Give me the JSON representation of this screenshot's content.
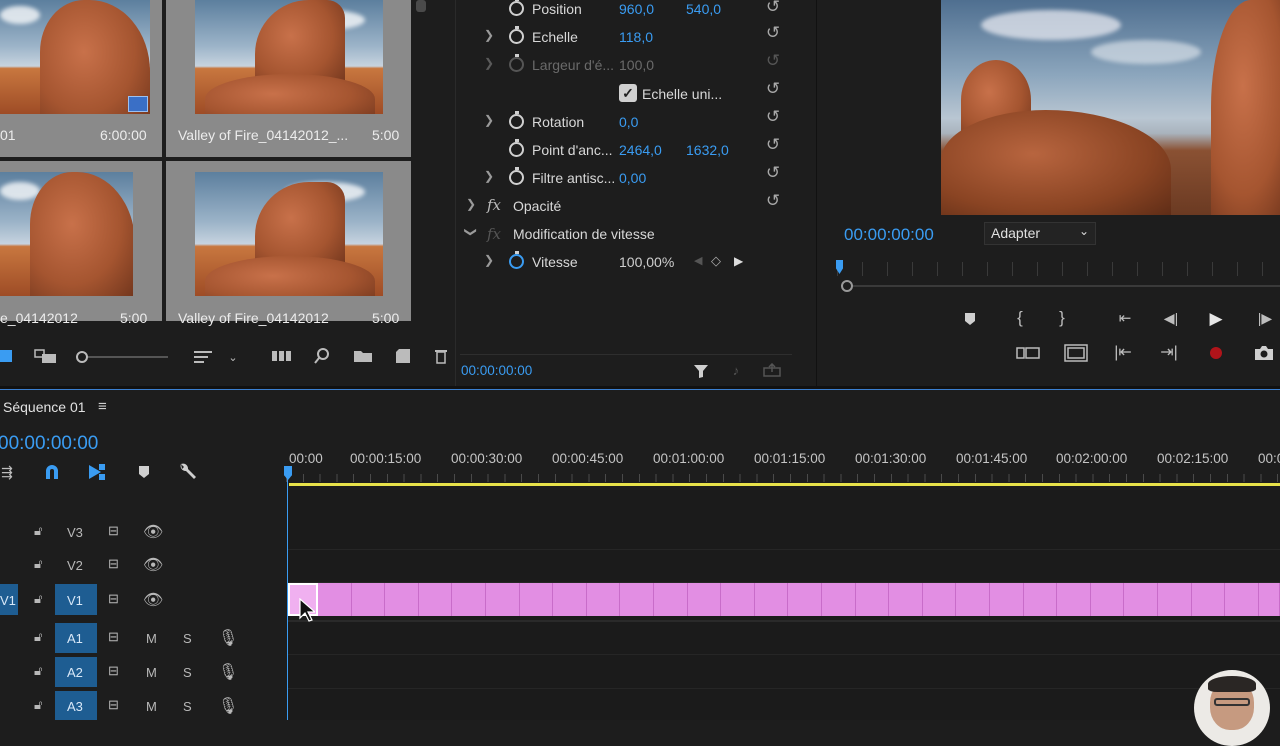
{
  "project": {
    "items": [
      {
        "name": "01",
        "duration": "6:00:00"
      },
      {
        "name": "Valley of Fire_04142012_...",
        "duration": "5:00"
      },
      {
        "name": "e_04142012",
        "duration": "5:00"
      },
      {
        "name": "Valley of Fire_04142012",
        "duration": "5:00"
      }
    ]
  },
  "effects": {
    "rows": [
      {
        "label": "Position",
        "v1": "960,0",
        "v2": "540,0"
      },
      {
        "label": "Echelle",
        "v1": "118,0",
        "v2": ""
      },
      {
        "label": "Largeur d'é...",
        "v1": "100,0",
        "v2": ""
      },
      {
        "label": "Echelle uni...",
        "v1": "",
        "v2": ""
      },
      {
        "label": "Rotation",
        "v1": "0,0",
        "v2": ""
      },
      {
        "label": "Point d'anc...",
        "v1": "2464,0",
        "v2": "1632,0"
      },
      {
        "label": "Filtre antisc...",
        "v1": "0,00",
        "v2": ""
      }
    ],
    "opacity_label": "Opacité",
    "speed_section_label": "Modification de vitesse",
    "speed_label": "Vitesse",
    "speed_value": "100,00%",
    "timecode": "00:00:00:00"
  },
  "program": {
    "timecode": "00:00:00:00",
    "fit_label": "Adapter"
  },
  "timeline": {
    "sequence_name": "Séquence 01",
    "timecode": "00:00:00:00",
    "ruler": [
      "00:00",
      "00:00:15:00",
      "00:00:30:00",
      "00:00:45:00",
      "00:01:00:00",
      "00:01:15:00",
      "00:01:30:00",
      "00:01:45:00",
      "00:02:00:00",
      "00:02:15:00",
      "00:0"
    ],
    "tracks": [
      {
        "name": "V3",
        "src": ""
      },
      {
        "name": "V2",
        "src": ""
      },
      {
        "name": "V1",
        "src": "V1"
      },
      {
        "name": "A1",
        "src": ""
      },
      {
        "name": "A2",
        "src": ""
      },
      {
        "name": "A3",
        "src": ""
      }
    ],
    "mute_label": "M",
    "solo_label": "S"
  },
  "colors": {
    "accent": "#3a9cf2",
    "clip": "#e28ee3",
    "workarea": "#e8e24a"
  }
}
